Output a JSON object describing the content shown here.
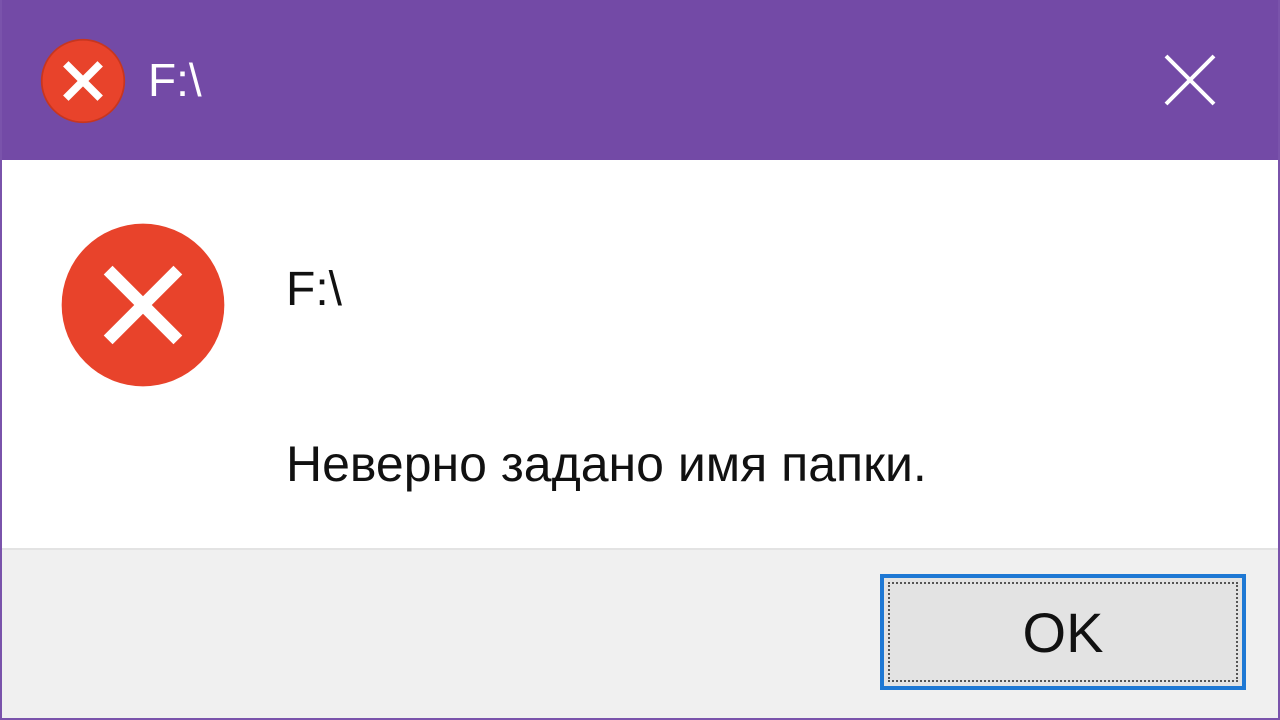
{
  "window": {
    "title": "F:\\",
    "titlebar_color": "#734aa6",
    "title_icon": "error-icon",
    "close_icon": "close-icon"
  },
  "content": {
    "icon": "error-icon",
    "icon_color": "#e8432b",
    "heading": "F:\\",
    "message": "Неверно задано имя папки."
  },
  "footer": {
    "ok_label": "OK",
    "ok_border_color": "#1e78d4"
  }
}
